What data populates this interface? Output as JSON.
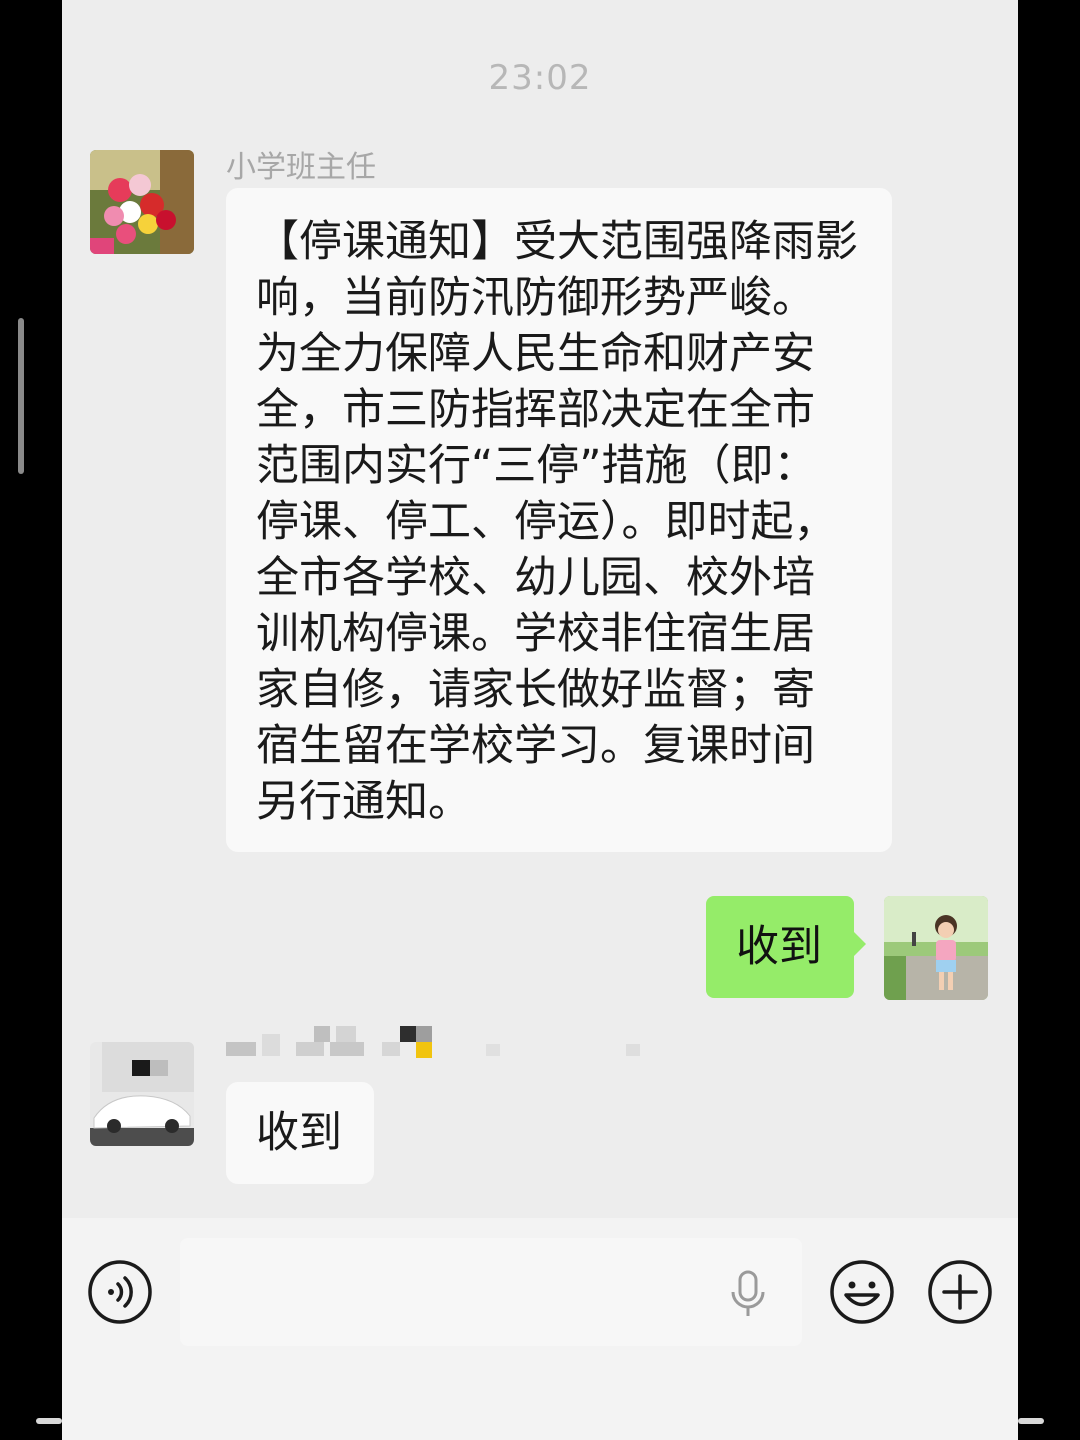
{
  "chat": {
    "timestamp": "23:02",
    "messages": [
      {
        "sender": "小学班主任",
        "direction": "incoming",
        "avatar": "flower-bouquet-avatar",
        "lines": [
          "【停课通知】受大范围强降雨影",
          "响，当前防汛防御形势严峻。",
          "为全力保障人民生命和财产安",
          "全，市三防指挥部决定在全市",
          "范围内实行“三停”措施（即：",
          "停课、停工、停运）。即时起，",
          "全市各学校、幼儿园、校外培",
          "训机构停课。学校非住宿生居",
          "家自修，请家长做好监督；寄",
          "宿生留在学校学习。复课时间",
          "另行通知。"
        ]
      },
      {
        "direction": "outgoing",
        "avatar": "child-photo-avatar",
        "text": "收到"
      },
      {
        "direction": "incoming",
        "avatar": "car-photo-avatar",
        "text": "收到"
      }
    ]
  },
  "input_bar": {
    "voice_icon": "voice-mode-icon",
    "mic_icon": "microphone-icon",
    "emoji_icon": "emoji-icon",
    "plus_icon": "plus-icon"
  },
  "colors": {
    "background": "#ededed",
    "outgoing_bubble": "#95ec69",
    "incoming_bubble": "#f9f9f9"
  }
}
